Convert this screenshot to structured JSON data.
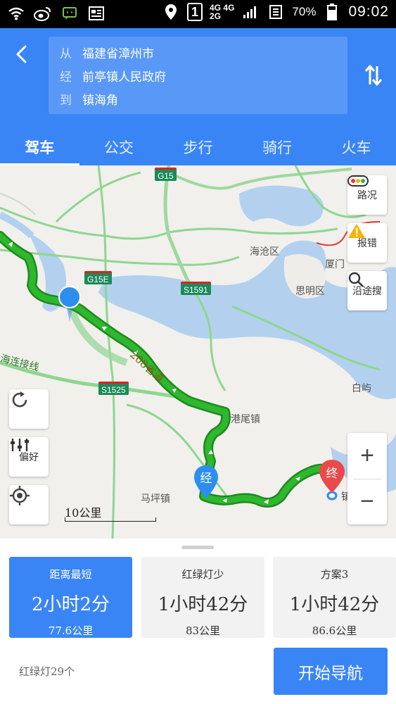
{
  "status_bar": {
    "sim_slot": "1",
    "network_top": "4G 4G",
    "network_bottom": "2G",
    "battery": "70%",
    "time": "09:02"
  },
  "header": {
    "from_tag": "从",
    "from": "福建省漳州市",
    "via_tag": "经",
    "via": "前亭镇人民政府",
    "to_tag": "到",
    "to": "镇海角"
  },
  "tabs": [
    "驾车",
    "公交",
    "步行",
    "骑行",
    "火车"
  ],
  "map": {
    "labels": {
      "district1": "海沧区",
      "xiamen": "厦门",
      "district2": "思明区",
      "town1": "港尾镇",
      "town2": "马坪镇",
      "island": "白屿",
      "road_left": "海连接线",
      "road_208": "208省道",
      "end_partial": "镇"
    },
    "shields": {
      "g15": "G15",
      "g15e": "G15E",
      "s1591": "S1591",
      "s1525": "S1525"
    },
    "buttons": {
      "traffic": "路况",
      "report": "报错",
      "search_along": "沿途搜",
      "preference": "偏好"
    },
    "via_marker": "经",
    "end_marker": "终",
    "scale": "10公里",
    "colors": {
      "route": "#2fb82f",
      "water": "#b3d1ef",
      "accent": "#3a85f6"
    }
  },
  "routes": [
    {
      "name": "距离最短",
      "time": "2小时2分",
      "distance": "77.6公里"
    },
    {
      "name": "红绿灯少",
      "time": "1小时42分",
      "distance": "83公里"
    },
    {
      "name": "方案3",
      "time": "1小时42分",
      "distance": "86.6公里"
    }
  ],
  "traffic_lights": "红绿灯29个",
  "start_nav": "开始导航"
}
